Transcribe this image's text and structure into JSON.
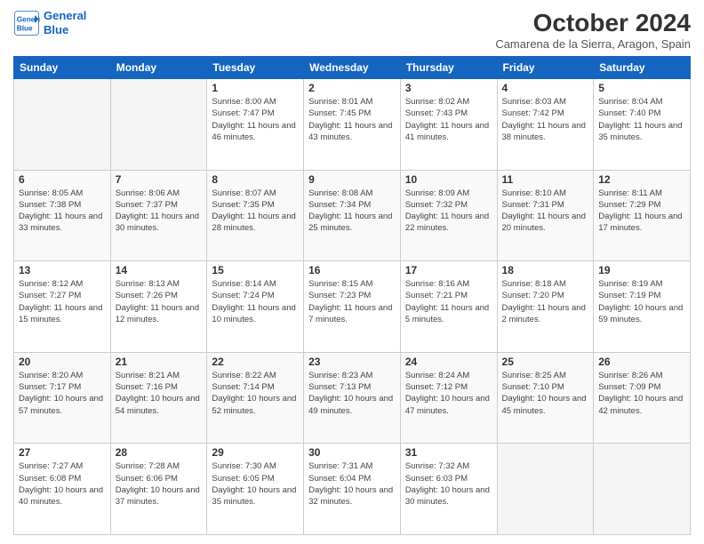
{
  "logo": {
    "line1": "General",
    "line2": "Blue"
  },
  "title": "October 2024",
  "subtitle": "Camarena de la Sierra, Aragon, Spain",
  "weekdays": [
    "Sunday",
    "Monday",
    "Tuesday",
    "Wednesday",
    "Thursday",
    "Friday",
    "Saturday"
  ],
  "weeks": [
    [
      {
        "day": "",
        "sunrise": "",
        "sunset": "",
        "daylight": ""
      },
      {
        "day": "",
        "sunrise": "",
        "sunset": "",
        "daylight": ""
      },
      {
        "day": "1",
        "sunrise": "Sunrise: 8:00 AM",
        "sunset": "Sunset: 7:47 PM",
        "daylight": "Daylight: 11 hours and 46 minutes."
      },
      {
        "day": "2",
        "sunrise": "Sunrise: 8:01 AM",
        "sunset": "Sunset: 7:45 PM",
        "daylight": "Daylight: 11 hours and 43 minutes."
      },
      {
        "day": "3",
        "sunrise": "Sunrise: 8:02 AM",
        "sunset": "Sunset: 7:43 PM",
        "daylight": "Daylight: 11 hours and 41 minutes."
      },
      {
        "day": "4",
        "sunrise": "Sunrise: 8:03 AM",
        "sunset": "Sunset: 7:42 PM",
        "daylight": "Daylight: 11 hours and 38 minutes."
      },
      {
        "day": "5",
        "sunrise": "Sunrise: 8:04 AM",
        "sunset": "Sunset: 7:40 PM",
        "daylight": "Daylight: 11 hours and 35 minutes."
      }
    ],
    [
      {
        "day": "6",
        "sunrise": "Sunrise: 8:05 AM",
        "sunset": "Sunset: 7:38 PM",
        "daylight": "Daylight: 11 hours and 33 minutes."
      },
      {
        "day": "7",
        "sunrise": "Sunrise: 8:06 AM",
        "sunset": "Sunset: 7:37 PM",
        "daylight": "Daylight: 11 hours and 30 minutes."
      },
      {
        "day": "8",
        "sunrise": "Sunrise: 8:07 AM",
        "sunset": "Sunset: 7:35 PM",
        "daylight": "Daylight: 11 hours and 28 minutes."
      },
      {
        "day": "9",
        "sunrise": "Sunrise: 8:08 AM",
        "sunset": "Sunset: 7:34 PM",
        "daylight": "Daylight: 11 hours and 25 minutes."
      },
      {
        "day": "10",
        "sunrise": "Sunrise: 8:09 AM",
        "sunset": "Sunset: 7:32 PM",
        "daylight": "Daylight: 11 hours and 22 minutes."
      },
      {
        "day": "11",
        "sunrise": "Sunrise: 8:10 AM",
        "sunset": "Sunset: 7:31 PM",
        "daylight": "Daylight: 11 hours and 20 minutes."
      },
      {
        "day": "12",
        "sunrise": "Sunrise: 8:11 AM",
        "sunset": "Sunset: 7:29 PM",
        "daylight": "Daylight: 11 hours and 17 minutes."
      }
    ],
    [
      {
        "day": "13",
        "sunrise": "Sunrise: 8:12 AM",
        "sunset": "Sunset: 7:27 PM",
        "daylight": "Daylight: 11 hours and 15 minutes."
      },
      {
        "day": "14",
        "sunrise": "Sunrise: 8:13 AM",
        "sunset": "Sunset: 7:26 PM",
        "daylight": "Daylight: 11 hours and 12 minutes."
      },
      {
        "day": "15",
        "sunrise": "Sunrise: 8:14 AM",
        "sunset": "Sunset: 7:24 PM",
        "daylight": "Daylight: 11 hours and 10 minutes."
      },
      {
        "day": "16",
        "sunrise": "Sunrise: 8:15 AM",
        "sunset": "Sunset: 7:23 PM",
        "daylight": "Daylight: 11 hours and 7 minutes."
      },
      {
        "day": "17",
        "sunrise": "Sunrise: 8:16 AM",
        "sunset": "Sunset: 7:21 PM",
        "daylight": "Daylight: 11 hours and 5 minutes."
      },
      {
        "day": "18",
        "sunrise": "Sunrise: 8:18 AM",
        "sunset": "Sunset: 7:20 PM",
        "daylight": "Daylight: 11 hours and 2 minutes."
      },
      {
        "day": "19",
        "sunrise": "Sunrise: 8:19 AM",
        "sunset": "Sunset: 7:19 PM",
        "daylight": "Daylight: 10 hours and 59 minutes."
      }
    ],
    [
      {
        "day": "20",
        "sunrise": "Sunrise: 8:20 AM",
        "sunset": "Sunset: 7:17 PM",
        "daylight": "Daylight: 10 hours and 57 minutes."
      },
      {
        "day": "21",
        "sunrise": "Sunrise: 8:21 AM",
        "sunset": "Sunset: 7:16 PM",
        "daylight": "Daylight: 10 hours and 54 minutes."
      },
      {
        "day": "22",
        "sunrise": "Sunrise: 8:22 AM",
        "sunset": "Sunset: 7:14 PM",
        "daylight": "Daylight: 10 hours and 52 minutes."
      },
      {
        "day": "23",
        "sunrise": "Sunrise: 8:23 AM",
        "sunset": "Sunset: 7:13 PM",
        "daylight": "Daylight: 10 hours and 49 minutes."
      },
      {
        "day": "24",
        "sunrise": "Sunrise: 8:24 AM",
        "sunset": "Sunset: 7:12 PM",
        "daylight": "Daylight: 10 hours and 47 minutes."
      },
      {
        "day": "25",
        "sunrise": "Sunrise: 8:25 AM",
        "sunset": "Sunset: 7:10 PM",
        "daylight": "Daylight: 10 hours and 45 minutes."
      },
      {
        "day": "26",
        "sunrise": "Sunrise: 8:26 AM",
        "sunset": "Sunset: 7:09 PM",
        "daylight": "Daylight: 10 hours and 42 minutes."
      }
    ],
    [
      {
        "day": "27",
        "sunrise": "Sunrise: 7:27 AM",
        "sunset": "Sunset: 6:08 PM",
        "daylight": "Daylight: 10 hours and 40 minutes."
      },
      {
        "day": "28",
        "sunrise": "Sunrise: 7:28 AM",
        "sunset": "Sunset: 6:06 PM",
        "daylight": "Daylight: 10 hours and 37 minutes."
      },
      {
        "day": "29",
        "sunrise": "Sunrise: 7:30 AM",
        "sunset": "Sunset: 6:05 PM",
        "daylight": "Daylight: 10 hours and 35 minutes."
      },
      {
        "day": "30",
        "sunrise": "Sunrise: 7:31 AM",
        "sunset": "Sunset: 6:04 PM",
        "daylight": "Daylight: 10 hours and 32 minutes."
      },
      {
        "day": "31",
        "sunrise": "Sunrise: 7:32 AM",
        "sunset": "Sunset: 6:03 PM",
        "daylight": "Daylight: 10 hours and 30 minutes."
      },
      {
        "day": "",
        "sunrise": "",
        "sunset": "",
        "daylight": ""
      },
      {
        "day": "",
        "sunrise": "",
        "sunset": "",
        "daylight": ""
      }
    ]
  ]
}
